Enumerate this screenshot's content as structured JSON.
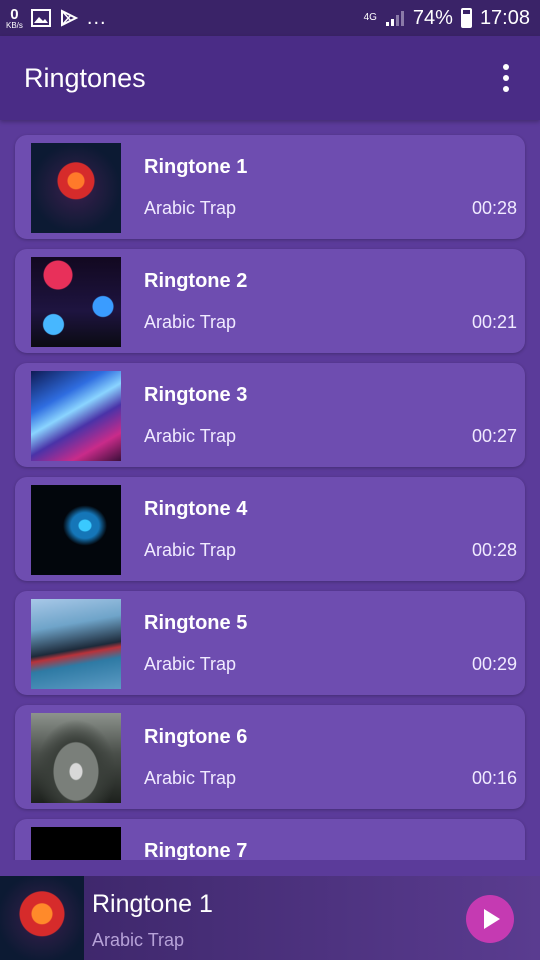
{
  "status_bar": {
    "speed_value": "0",
    "speed_unit": "KB/s",
    "dots": "...",
    "network": "4G",
    "battery": "74%",
    "time": "17:08",
    "icons": [
      "image-icon",
      "play-store-icon",
      "signal-icon",
      "battery-icon"
    ]
  },
  "app_bar": {
    "title": "Ringtones",
    "overflow_icon": "more-vert-icon"
  },
  "ringtones": [
    {
      "title": "Ringtone 1",
      "artist": "Arabic Trap",
      "duration": "00:28"
    },
    {
      "title": "Ringtone 2",
      "artist": "Arabic Trap",
      "duration": "00:21"
    },
    {
      "title": "Ringtone 3",
      "artist": "Arabic Trap",
      "duration": "00:27"
    },
    {
      "title": "Ringtone 4",
      "artist": "Arabic Trap",
      "duration": "00:28"
    },
    {
      "title": "Ringtone 5",
      "artist": "Arabic Trap",
      "duration": "00:29"
    },
    {
      "title": "Ringtone 6",
      "artist": "Arabic Trap",
      "duration": "00:16"
    },
    {
      "title": "Ringtone 7",
      "artist": "",
      "duration": ""
    }
  ],
  "player": {
    "title": "Ringtone 1",
    "artist": "Arabic Trap",
    "play_icon": "play-icon",
    "accent": "#c53ab2"
  },
  "colors": {
    "background": "#5b3b9a",
    "app_bar": "#4a2c86",
    "card": "#6e4db0"
  }
}
